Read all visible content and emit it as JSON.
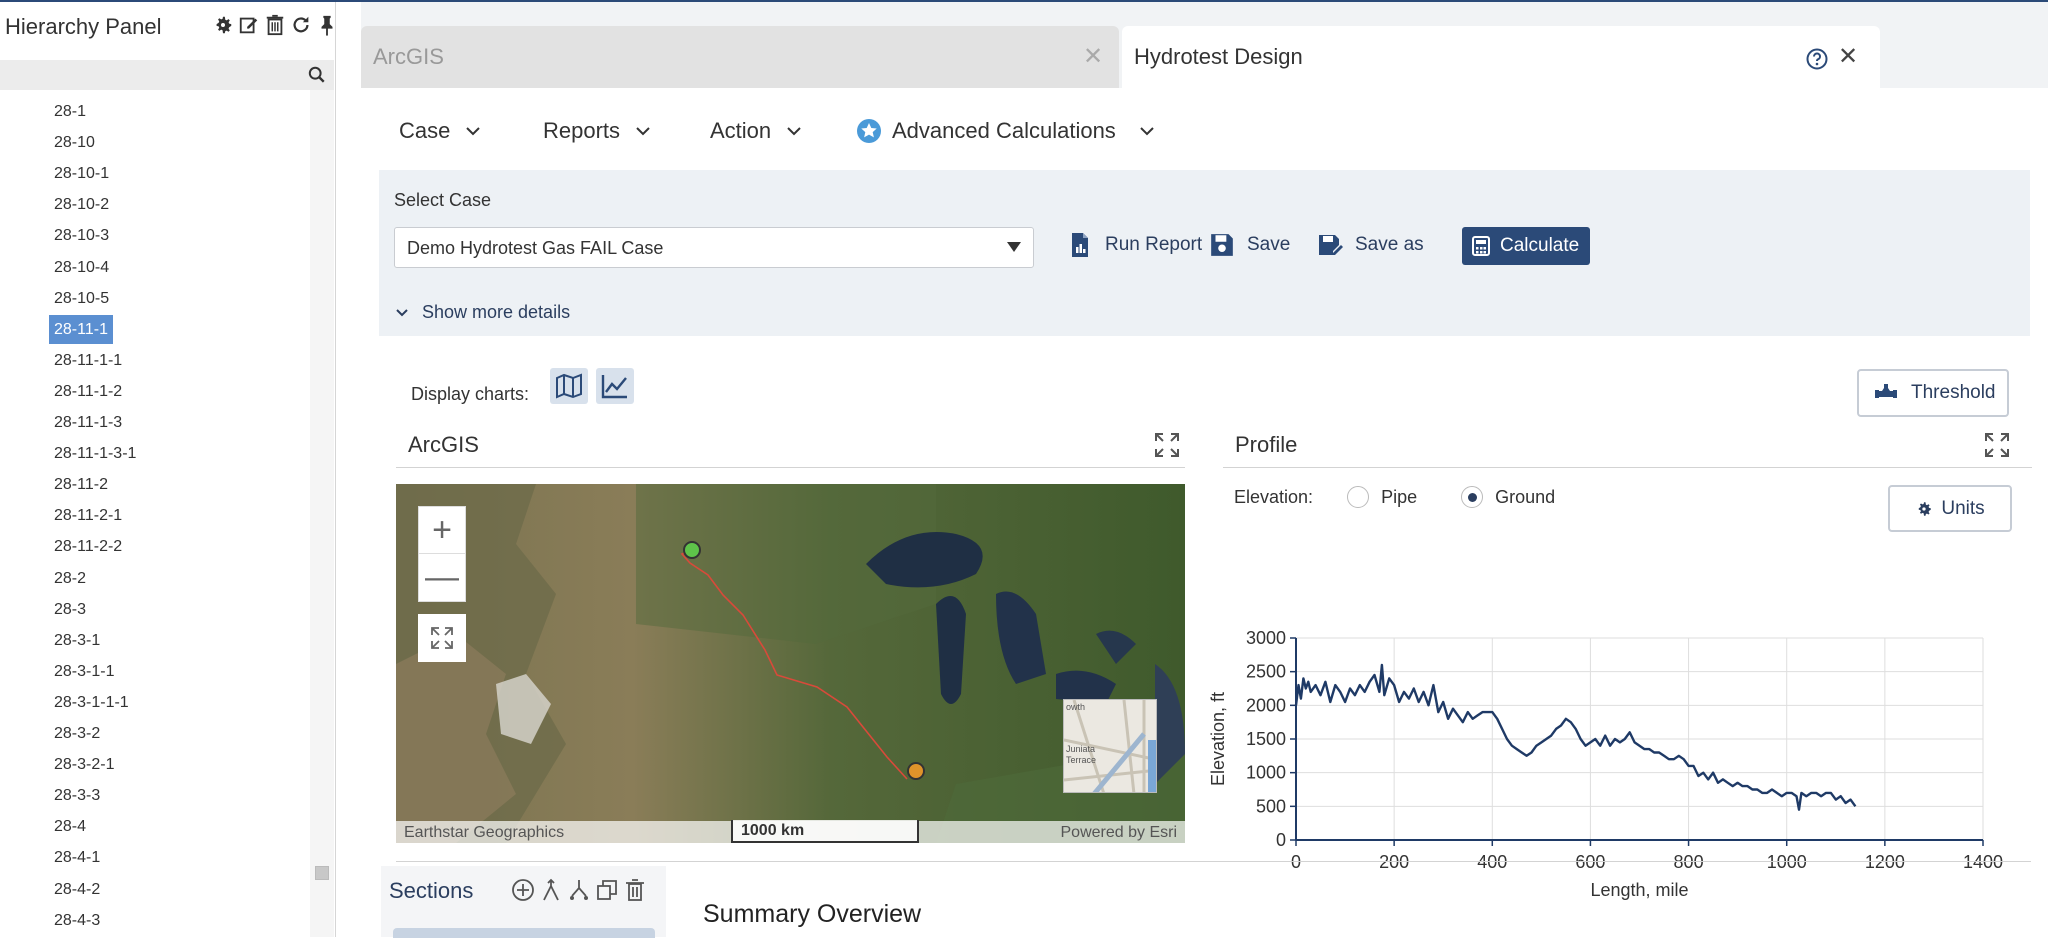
{
  "hierarchy": {
    "title": "Hierarchy Panel",
    "tools": [
      "settings-icon",
      "edit-icon",
      "delete-icon",
      "refresh-icon",
      "pin-icon"
    ],
    "search_placeholder": "",
    "items": [
      {
        "label": "28-1",
        "selected": false
      },
      {
        "label": "28-10",
        "selected": false
      },
      {
        "label": "28-10-1",
        "selected": false
      },
      {
        "label": "28-10-2",
        "selected": false
      },
      {
        "label": "28-10-3",
        "selected": false
      },
      {
        "label": "28-10-4",
        "selected": false
      },
      {
        "label": "28-10-5",
        "selected": false
      },
      {
        "label": "28-11-1",
        "selected": true
      },
      {
        "label": "28-11-1-1",
        "selected": false
      },
      {
        "label": "28-11-1-2",
        "selected": false
      },
      {
        "label": "28-11-1-3",
        "selected": false
      },
      {
        "label": "28-11-1-3-1",
        "selected": false
      },
      {
        "label": "28-11-2",
        "selected": false
      },
      {
        "label": "28-11-2-1",
        "selected": false
      },
      {
        "label": "28-11-2-2",
        "selected": false
      },
      {
        "label": "28-2",
        "selected": false
      },
      {
        "label": "28-3",
        "selected": false
      },
      {
        "label": "28-3-1",
        "selected": false
      },
      {
        "label": "28-3-1-1",
        "selected": false
      },
      {
        "label": "28-3-1-1-1",
        "selected": false
      },
      {
        "label": "28-3-2",
        "selected": false
      },
      {
        "label": "28-3-2-1",
        "selected": false
      },
      {
        "label": "28-3-3",
        "selected": false
      },
      {
        "label": "28-4",
        "selected": false
      },
      {
        "label": "28-4-1",
        "selected": false
      },
      {
        "label": "28-4-2",
        "selected": false
      },
      {
        "label": "28-4-3",
        "selected": false
      }
    ]
  },
  "tabs": {
    "inactive_label": "ArcGIS",
    "active_label": "Hydrotest Design",
    "close_glyph": "✕"
  },
  "menubar": {
    "case": "Case",
    "reports": "Reports",
    "action": "Action",
    "advanced": "Advanced Calculations"
  },
  "case_panel": {
    "label": "Select Case",
    "selected": "Demo Hydrotest Gas FAIL Case",
    "run_report": "Run Report",
    "save": "Save",
    "save_as": "Save as",
    "calculate": "Calculate",
    "more_details": "Show more details"
  },
  "display": {
    "label": "Display charts:",
    "threshold": "Threshold"
  },
  "map_panel": {
    "title": "ArcGIS",
    "attribution": "Earthstar Geographics",
    "scale": "1000 km",
    "powered": "Powered by Esri",
    "zoom_in": "+",
    "zoom_out": "—",
    "inset_labels": [
      "owth",
      "Juniata",
      "Terrace"
    ]
  },
  "profile_panel": {
    "title": "Profile",
    "elevation_label": "Elevation:",
    "pipe": "Pipe",
    "ground": "Ground",
    "selected": "Ground",
    "units": "Units"
  },
  "chart_data": {
    "type": "line",
    "xlabel": "Length, mile",
    "ylabel": "Elevation, ft",
    "xlim": [
      0,
      1400
    ],
    "ylim": [
      0,
      3000
    ],
    "xticks": [
      0,
      200,
      400,
      600,
      800,
      1000,
      1200,
      1400
    ],
    "yticks": [
      0,
      500,
      1000,
      1500,
      2000,
      2500,
      3000
    ],
    "grid": true,
    "color": "#1f3a66",
    "series": [
      {
        "x": [
          0,
          5,
          10,
          15,
          20,
          25,
          30,
          40,
          50,
          60,
          70,
          80,
          90,
          100,
          110,
          120,
          130,
          140,
          150,
          160,
          170,
          175,
          180,
          190,
          200,
          210,
          220,
          230,
          240,
          250,
          260,
          270,
          280,
          290,
          300,
          310,
          320,
          330,
          340,
          350,
          360,
          370,
          380,
          390,
          400,
          410,
          420,
          430,
          440,
          450,
          460,
          470,
          480,
          490,
          500,
          510,
          520,
          530,
          540,
          550,
          560,
          570,
          580,
          590,
          600,
          610,
          620,
          630,
          640,
          650,
          660,
          670,
          680,
          690,
          700,
          710,
          720,
          730,
          740,
          750,
          760,
          770,
          780,
          790,
          800,
          810,
          820,
          830,
          840,
          850,
          860,
          870,
          880,
          890,
          900,
          910,
          920,
          930,
          940,
          950,
          960,
          970,
          980,
          990,
          1000,
          1010,
          1020,
          1025,
          1030,
          1040,
          1050,
          1060,
          1070,
          1080,
          1090,
          1100,
          1110,
          1120,
          1130,
          1140
        ],
        "values": [
          2000,
          2300,
          2100,
          2400,
          2250,
          2350,
          2200,
          2300,
          2150,
          2350,
          2050,
          2300,
          2200,
          2050,
          2250,
          2150,
          2300,
          2200,
          2350,
          2450,
          2200,
          2600,
          2150,
          2400,
          2300,
          2050,
          2200,
          2100,
          2250,
          2050,
          2200,
          2000,
          2300,
          1900,
          2050,
          1800,
          1950,
          1850,
          1750,
          1900,
          1800,
          1850,
          1900,
          1900,
          1900,
          1800,
          1650,
          1500,
          1400,
          1350,
          1300,
          1250,
          1300,
          1400,
          1450,
          1500,
          1550,
          1650,
          1700,
          1800,
          1750,
          1650,
          1500,
          1400,
          1450,
          1500,
          1400,
          1550,
          1400,
          1500,
          1450,
          1500,
          1600,
          1450,
          1400,
          1350,
          1350,
          1300,
          1300,
          1250,
          1200,
          1200,
          1250,
          1200,
          1100,
          1100,
          950,
          1000,
          900,
          1000,
          850,
          900,
          850,
          800,
          850,
          800,
          800,
          750,
          750,
          700,
          700,
          750,
          700,
          650,
          700,
          700,
          650,
          450,
          700,
          650,
          700,
          700,
          650,
          700,
          700,
          600,
          650,
          550,
          600,
          500
        ]
      }
    ]
  },
  "sections": {
    "title": "Sections"
  },
  "summary": {
    "title": "Summary Overview"
  }
}
